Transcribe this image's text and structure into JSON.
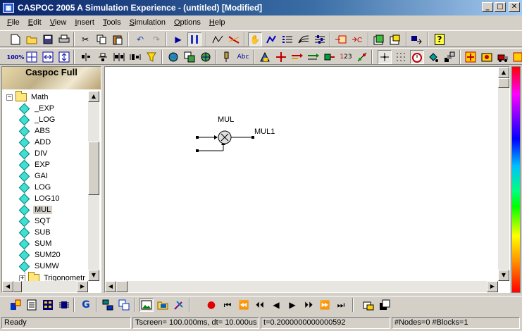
{
  "window": {
    "title": "CASPOC 2005 A Simulation Experience - (untitled) [Modified]",
    "minimize": "_",
    "maximize": "□",
    "close": "✕"
  },
  "menu": [
    {
      "label": "File",
      "u": "F",
      "rest": "ile"
    },
    {
      "label": "Edit",
      "u": "E",
      "rest": "dit"
    },
    {
      "label": "View",
      "u": "V",
      "rest": "iew"
    },
    {
      "label": "Insert",
      "u": "I",
      "rest": "nsert"
    },
    {
      "label": "Tools",
      "u": "T",
      "rest": "ools"
    },
    {
      "label": "Simulation",
      "u": "S",
      "rest": "imulation"
    },
    {
      "label": "Options",
      "u": "O",
      "rest": "ptions"
    },
    {
      "label": "Help",
      "u": "H",
      "rest": "elp"
    }
  ],
  "library": {
    "banner": "Caspoc Full",
    "folder": "Math",
    "folder_expander": "−",
    "items": [
      "_EXP",
      "_LOG",
      "ABS",
      "ADD",
      "DIV",
      "EXP",
      "GAI",
      "LOG",
      "LOG10",
      "MUL",
      "SQT",
      "SUB",
      "SUM",
      "SUM20",
      "SUMW"
    ],
    "selected": "MUL",
    "next_folder": "Trigonometr",
    "next_expander": "+"
  },
  "schematic": {
    "block_label": "MUL",
    "output_label": "MUL1",
    "symbol": "×"
  },
  "status": {
    "ready": "Ready",
    "tscreen": "Tscreen= 100.000ms, dt= 10.000us",
    "time": "t=0.2000000000000592",
    "counts": "#Nodes=0 #Blocks=1"
  },
  "colors": {
    "title_start": "#0a246a",
    "title_end": "#a6caf0",
    "chrome": "#d4d0c8",
    "block_icon": "#40e0d0"
  }
}
